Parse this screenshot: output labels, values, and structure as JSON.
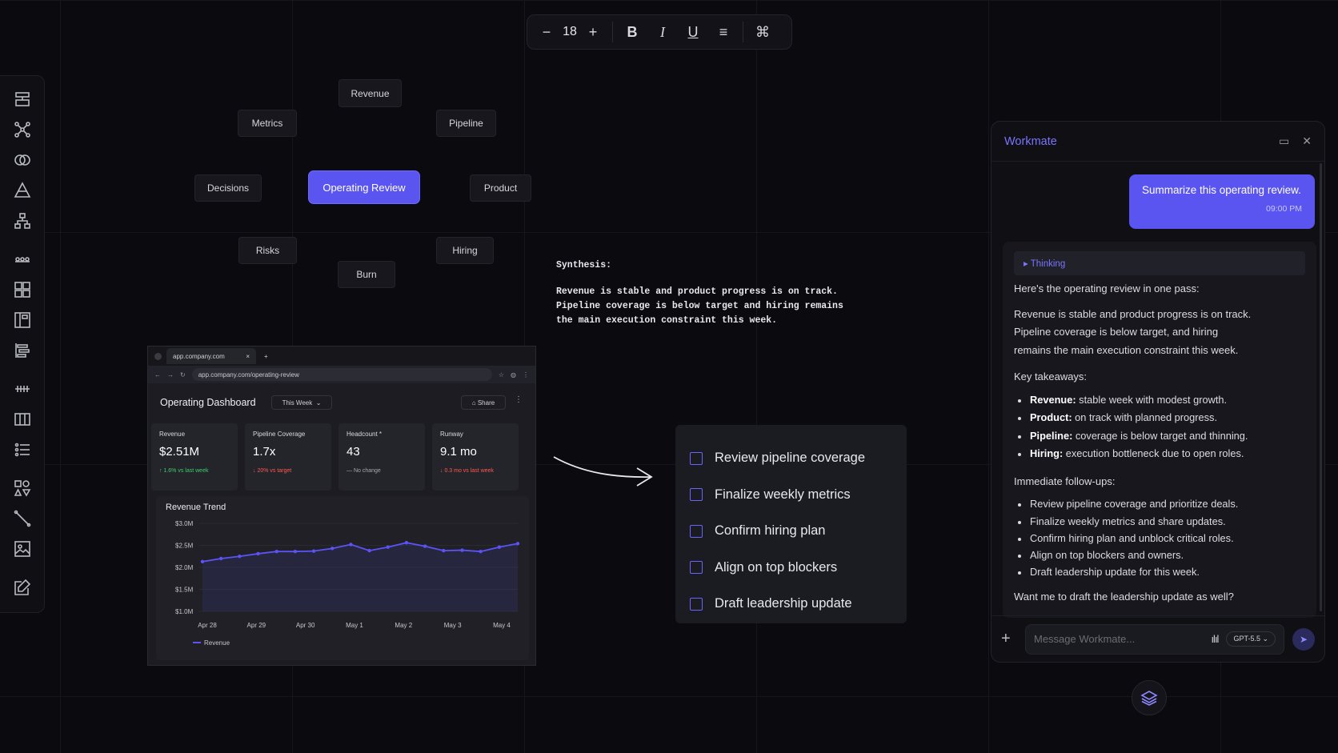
{
  "toolbar": {
    "minus": "−",
    "font_size": "18",
    "plus": "+",
    "bold": "B",
    "italic": "I",
    "underline": "U",
    "list": "≡",
    "command": "⌘"
  },
  "mindmap": {
    "center": "Operating Review",
    "nodes": [
      "Revenue",
      "Metrics",
      "Pipeline",
      "Decisions",
      "Product",
      "Risks",
      "Hiring",
      "Burn"
    ]
  },
  "synthesis": {
    "heading": "Synthesis:",
    "lines": [
      "Revenue is stable and product progress is on track.",
      "Pipeline coverage is below target and hiring remains",
      "the main execution constraint this week."
    ]
  },
  "browser": {
    "tab_label": "app.company.com",
    "tab_close": "×",
    "new_tab": "+",
    "url": "app.company.com/operating-review",
    "dashboard": {
      "title": "Operating Dashboard",
      "range": "This Week",
      "share": "Share",
      "kpis": [
        {
          "label": "Revenue",
          "value": "$2.51M",
          "delta": "↑ 1.6% vs last week",
          "delta_color": "#3fcf6a"
        },
        {
          "label": "Pipeline Coverage",
          "value": "1.7x",
          "delta": "↓ 20% vs target",
          "delta_color": "#ff5a4f"
        },
        {
          "label": "Headcount *",
          "value": "43",
          "delta": "— No change",
          "delta_color": "#a8a8b0"
        },
        {
          "label": "Runway",
          "value": "9.1 mo",
          "delta": "↓ 0.3 mo vs last week",
          "delta_color": "#ff5a4f"
        }
      ]
    }
  },
  "chart_data": {
    "type": "line",
    "title": "Revenue Trend",
    "x_ticks": [
      "Apr 28",
      "Apr 29",
      "Apr 30",
      "May 1",
      "May 2",
      "May 3",
      "May 4"
    ],
    "y_ticks": [
      "$3.0M",
      "$2.5M",
      "$2.0M",
      "$1.5M",
      "$1.0M"
    ],
    "ylim": [
      1.0,
      3.0
    ],
    "series": [
      {
        "name": "Revenue",
        "color": "#5b53f5",
        "values": [
          2.13,
          2.2,
          2.25,
          2.31,
          2.36,
          2.36,
          2.37,
          2.43,
          2.52,
          2.38,
          2.46,
          2.56,
          2.48,
          2.38,
          2.39,
          2.36,
          2.46,
          2.54
        ]
      }
    ],
    "legend": "bottom-left"
  },
  "checklist": {
    "items": [
      "Review pipeline coverage",
      "Finalize weekly metrics",
      "Confirm hiring plan",
      "Align on top blockers",
      "Draft leadership update"
    ]
  },
  "workmate": {
    "title": "Workmate",
    "user_message": "Summarize this operating review.",
    "user_time": "09:00 PM",
    "thinking": "▸ Thinking",
    "intro": "Here's the operating review in one pass:",
    "summary_lines": [
      "Revenue is stable and product progress is on track.",
      "Pipeline coverage is below target, and hiring",
      "remains the main execution constraint this week."
    ],
    "takeaways_heading": "Key takeaways:",
    "takeaways": [
      {
        "term": "Revenue:",
        "text": " stable week with modest growth."
      },
      {
        "term": "Product:",
        "text": " on track with planned progress."
      },
      {
        "term": "Pipeline:",
        "text": " coverage is below target and thinning."
      },
      {
        "term": "Hiring:",
        "text": " execution bottleneck due to open roles."
      }
    ],
    "followups_heading": "Immediate follow-ups:",
    "followups": [
      "Review pipeline coverage and prioritize deals.",
      "Finalize weekly metrics and share updates.",
      "Confirm hiring plan and unblock critical roles.",
      "Align on top blockers and owners.",
      "Draft leadership update for this week."
    ],
    "closing": "Want me to draft the leadership update as well?",
    "input_placeholder": "Message Workmate...",
    "model": "GPT-5.5 ⌄",
    "add": "+"
  }
}
